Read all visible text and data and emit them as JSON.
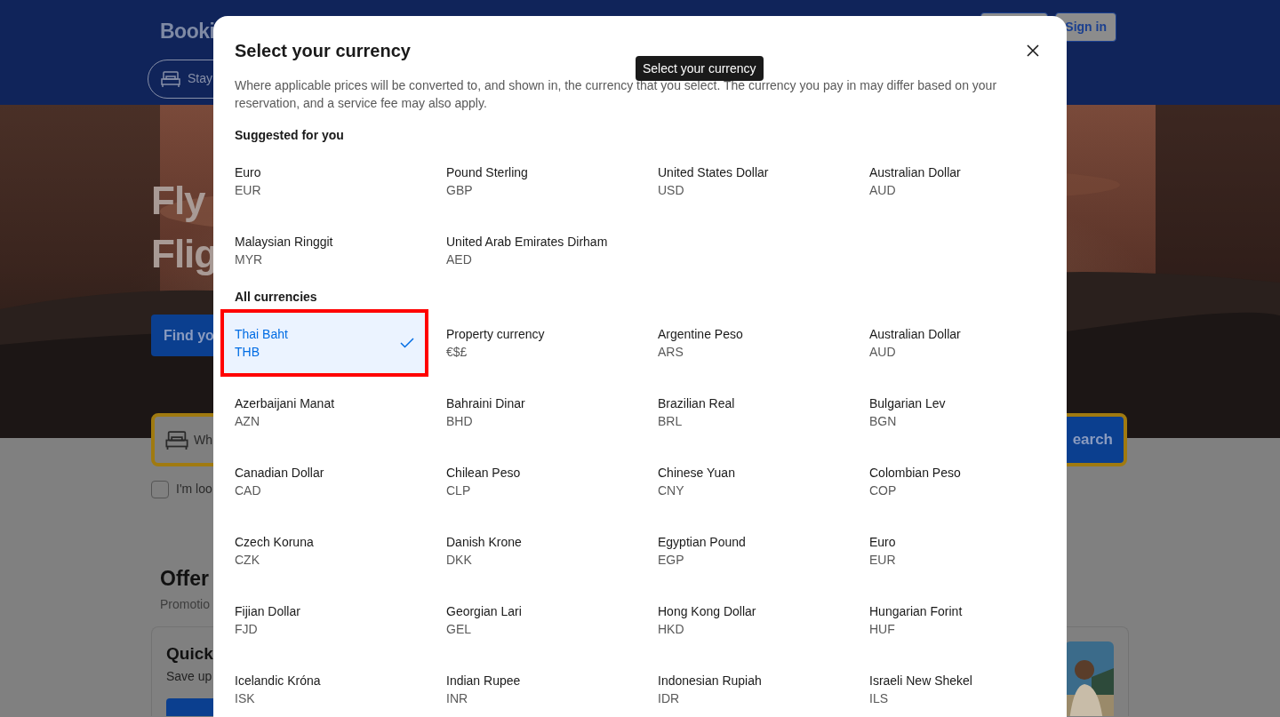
{
  "background_page": {
    "logo": "Booki",
    "nav_tab": "Stay",
    "sign_in_button": "Sign in",
    "hero_lines": [
      "Fly",
      "Flig"
    ],
    "hero_button": "Find yo",
    "search_field": "Wh",
    "search_button": "earch",
    "checkbox": {
      "label": "I'm loo",
      "checked": false
    },
    "offers_title": "Offer",
    "offers_subtitle": "Promotio",
    "card": {
      "title": "Quick",
      "text": "Save up",
      "kind": "picture"
    }
  },
  "tooltip": "Select your currency",
  "dialog": {
    "title": "Select your currency",
    "description": "Where applicable prices will be converted to, and shown in, the currency that you select. The currency you pay in may differ based on your reservation, and a service fee may also apply.",
    "sections": [
      {
        "heading": "Suggested for you",
        "items": [
          {
            "name": "Euro",
            "code": "EUR",
            "selected": false,
            "outlined": false
          },
          {
            "name": "Pound Sterling",
            "code": "GBP",
            "selected": false,
            "outlined": false
          },
          {
            "name": "United States Dollar",
            "code": "USD",
            "selected": false,
            "outlined": false
          },
          {
            "name": "Australian Dollar",
            "code": "AUD",
            "selected": false,
            "outlined": false
          },
          {
            "name": "Malaysian Ringgit",
            "code": "MYR",
            "selected": false,
            "outlined": false
          },
          {
            "name": "United Arab Emirates Dirham",
            "code": "AED",
            "selected": false,
            "outlined": false
          }
        ]
      },
      {
        "heading": "All currencies",
        "items": [
          {
            "name": "Thai Baht",
            "code": "THB",
            "selected": true,
            "outlined": true
          },
          {
            "name": "Property currency",
            "code": "€$£",
            "selected": false,
            "outlined": false
          },
          {
            "name": "Argentine Peso",
            "code": "ARS",
            "selected": false,
            "outlined": false
          },
          {
            "name": "Australian Dollar",
            "code": "AUD",
            "selected": false,
            "outlined": false
          },
          {
            "name": "Azerbaijani Manat",
            "code": "AZN",
            "selected": false,
            "outlined": false
          },
          {
            "name": "Bahraini Dinar",
            "code": "BHD",
            "selected": false,
            "outlined": false
          },
          {
            "name": "Brazilian Real",
            "code": "BRL",
            "selected": false,
            "outlined": false
          },
          {
            "name": "Bulgarian Lev",
            "code": "BGN",
            "selected": false,
            "outlined": false
          },
          {
            "name": "Canadian Dollar",
            "code": "CAD",
            "selected": false,
            "outlined": false
          },
          {
            "name": "Chilean Peso",
            "code": "CLP",
            "selected": false,
            "outlined": false
          },
          {
            "name": "Chinese Yuan",
            "code": "CNY",
            "selected": false,
            "outlined": false
          },
          {
            "name": "Colombian Peso",
            "code": "COP",
            "selected": false,
            "outlined": false
          },
          {
            "name": "Czech Koruna",
            "code": "CZK",
            "selected": false,
            "outlined": false
          },
          {
            "name": "Danish Krone",
            "code": "DKK",
            "selected": false,
            "outlined": false
          },
          {
            "name": "Egyptian Pound",
            "code": "EGP",
            "selected": false,
            "outlined": false
          },
          {
            "name": "Euro",
            "code": "EUR",
            "selected": false,
            "outlined": false
          },
          {
            "name": "Fijian Dollar",
            "code": "FJD",
            "selected": false,
            "outlined": false
          },
          {
            "name": "Georgian Lari",
            "code": "GEL",
            "selected": false,
            "outlined": false
          },
          {
            "name": "Hong Kong Dollar",
            "code": "HKD",
            "selected": false,
            "outlined": false
          },
          {
            "name": "Hungarian Forint",
            "code": "HUF",
            "selected": false,
            "outlined": false
          },
          {
            "name": "Icelandic Króna",
            "code": "ISK",
            "selected": false,
            "outlined": false
          },
          {
            "name": "Indian Rupee",
            "code": "INR",
            "selected": false,
            "outlined": false
          },
          {
            "name": "Indonesian Rupiah",
            "code": "IDR",
            "selected": false,
            "outlined": false
          },
          {
            "name": "Israeli New Shekel",
            "code": "ILS",
            "selected": false,
            "outlined": false
          }
        ]
      }
    ]
  }
}
